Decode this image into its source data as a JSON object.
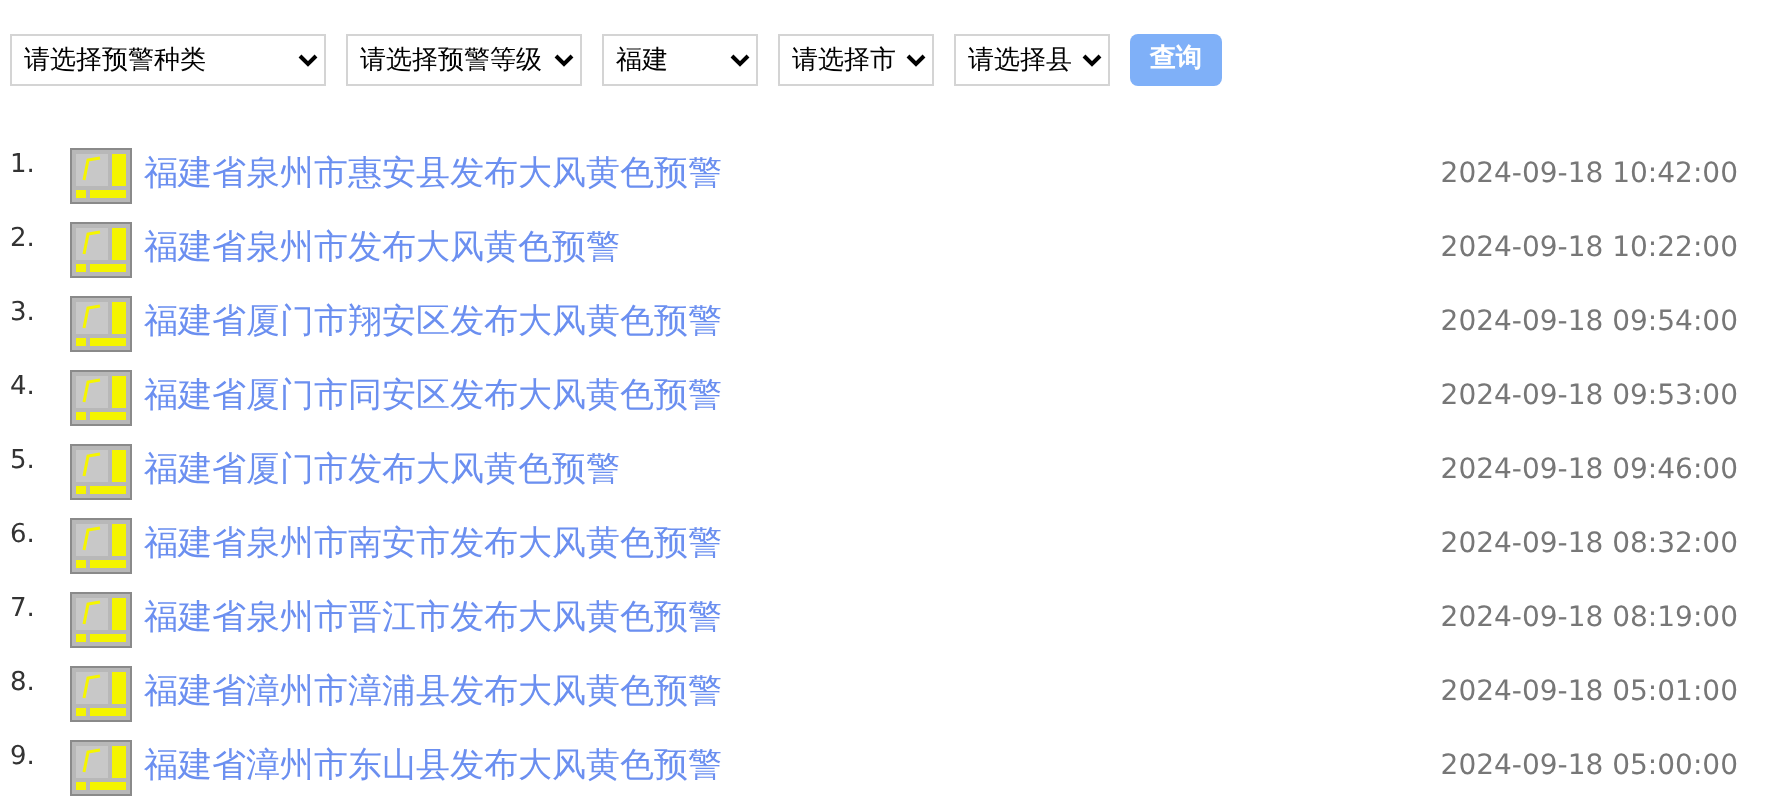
{
  "filters": [
    {
      "value": "请选择预警种类"
    },
    {
      "value": "请选择预警等级"
    },
    {
      "value": "福建"
    },
    {
      "value": "请选择市"
    },
    {
      "value": "请选择县"
    }
  ],
  "search_button": "查询",
  "alerts": [
    {
      "number": "1.",
      "title": "福建省泉州市惠安县发布大风黄色预警",
      "time": "2024-09-18 10:42:00"
    },
    {
      "number": "2.",
      "title": "福建省泉州市发布大风黄色预警",
      "time": "2024-09-18 10:22:00"
    },
    {
      "number": "3.",
      "title": "福建省厦门市翔安区发布大风黄色预警",
      "time": "2024-09-18 09:54:00"
    },
    {
      "number": "4.",
      "title": "福建省厦门市同安区发布大风黄色预警",
      "time": "2024-09-18 09:53:00"
    },
    {
      "number": "5.",
      "title": "福建省厦门市发布大风黄色预警",
      "time": "2024-09-18 09:46:00"
    },
    {
      "number": "6.",
      "title": "福建省泉州市南安市发布大风黄色预警",
      "time": "2024-09-18 08:32:00"
    },
    {
      "number": "7.",
      "title": "福建省泉州市晋江市发布大风黄色预警",
      "time": "2024-09-18 08:19:00"
    },
    {
      "number": "8.",
      "title": "福建省漳州市漳浦县发布大风黄色预警",
      "time": "2024-09-18 05:01:00"
    },
    {
      "number": "9.",
      "title": "福建省漳州市东山县发布大风黄色预警",
      "time": "2024-09-18 05:00:00"
    }
  ]
}
